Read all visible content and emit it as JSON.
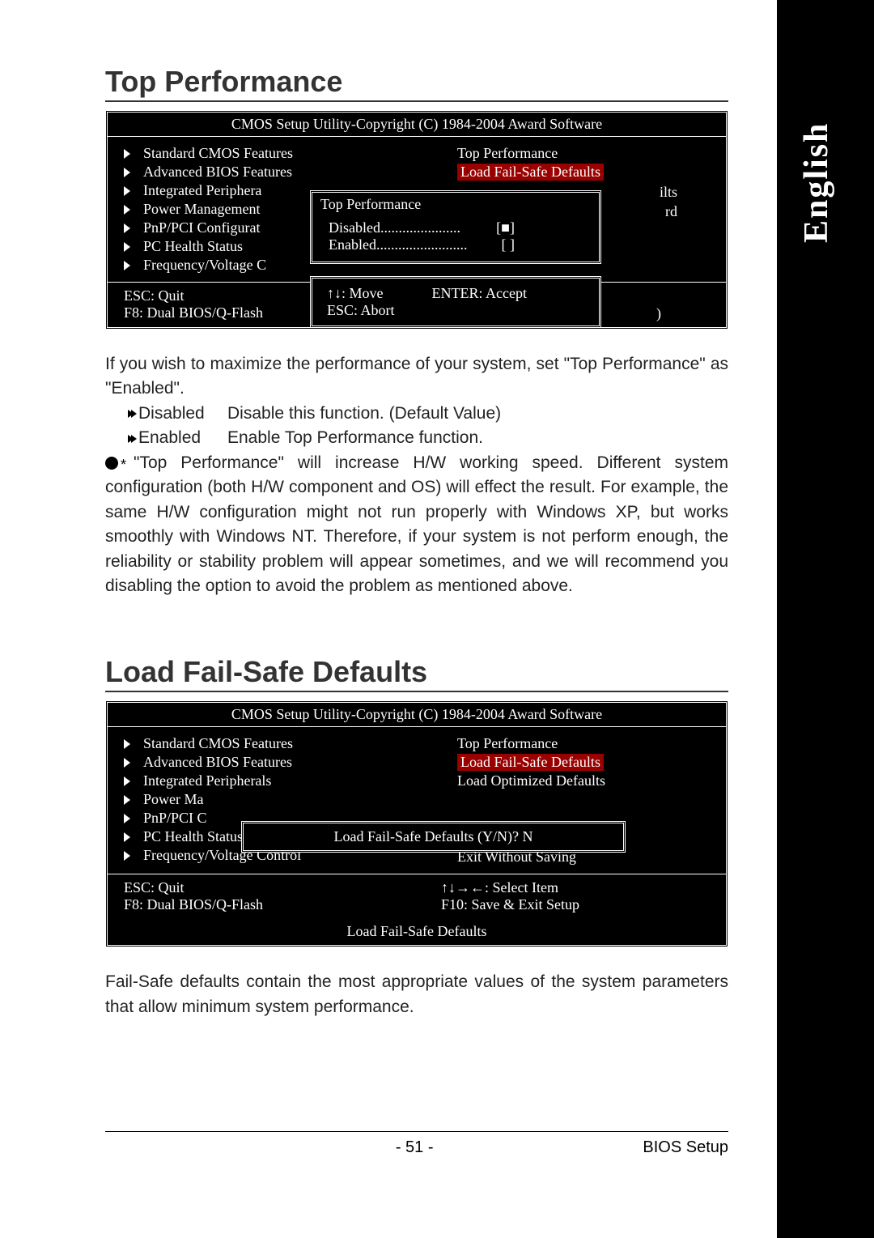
{
  "language_tab": "English",
  "section1": {
    "title": "Top Performance",
    "bios": {
      "title": "CMOS Setup Utility-Copyright (C) 1984-2004 Award Software",
      "left": [
        "Standard CMOS Features",
        "Advanced BIOS Features",
        "Integrated Periphera",
        "Power Management",
        "PnP/PCI Configurat",
        "PC Health Status",
        "Frequency/Voltage C"
      ],
      "right_top": "Top Performance",
      "right_hl": "Load Fail-Safe Defaults",
      "cut1": "ilts",
      "cut2": "rd",
      "footer_left1": "ESC: Quit",
      "footer_left2": "F8: Dual BIOS/Q-Flash",
      "footer_right_partial": ")",
      "overlay": {
        "title": "Top Performance",
        "opt1_label": "Disabled",
        "opt1_dots": "......................",
        "opt1_state": "[■]",
        "opt2_label": "Enabled",
        "opt2_dots": ".........................",
        "opt2_state": "[  ]",
        "foot_move": "↑↓: Move",
        "foot_accept": "ENTER: Accept",
        "foot_abort": "ESC: Abort"
      }
    },
    "body_intro": "If you wish to maximize the performance of your system, set \"Top Performance\" as \"Enabled\".",
    "opt_disabled_label": "Disabled",
    "opt_disabled_desc": "Disable this function. (Default Value)",
    "opt_enabled_label": "Enabled",
    "opt_enabled_desc": "Enable Top Performance function.",
    "note": "\"Top Performance\" will increase H/W working speed. Different system configuration (both H/W component and OS) will effect the result. For example, the same H/W configuration might not run properly with Windows XP, but works smoothly with Windows NT. Therefore, if your system is not perform enough, the reliability or stability problem will appear sometimes, and we will recommend you disabling the option to avoid the problem as mentioned above."
  },
  "section2": {
    "title": "Load Fail-Safe Defaults",
    "bios": {
      "title": "CMOS Setup Utility-Copyright (C) 1984-2004 Award Software",
      "left": [
        "Standard CMOS Features",
        "Advanced BIOS Features",
        "Integrated Peripherals",
        "Power Ma",
        "PnP/PCI C",
        "PC Health Status",
        "Frequency/Voltage Control"
      ],
      "right": [
        "Top Performance",
        "Load Fail-Safe Defaults",
        "Load Optimized Defaults",
        "",
        "",
        "Save & Exit Setup",
        "Exit Without Saving"
      ],
      "right_hl_index": 1,
      "overlay_prompt": "Load Fail-Safe Defaults (Y/N)? N",
      "footer_left1": "ESC: Quit",
      "footer_left2": "F8: Dual BIOS/Q-Flash",
      "footer_right1": "↑↓→←: Select Item",
      "footer_right2": "F10: Save & Exit Setup",
      "status": "Load Fail-Safe Defaults"
    },
    "body": "Fail-Safe defaults contain the most appropriate values of the system parameters that allow minimum system performance."
  },
  "page_footer": {
    "page_num": "- 51 -",
    "section": "BIOS Setup"
  }
}
